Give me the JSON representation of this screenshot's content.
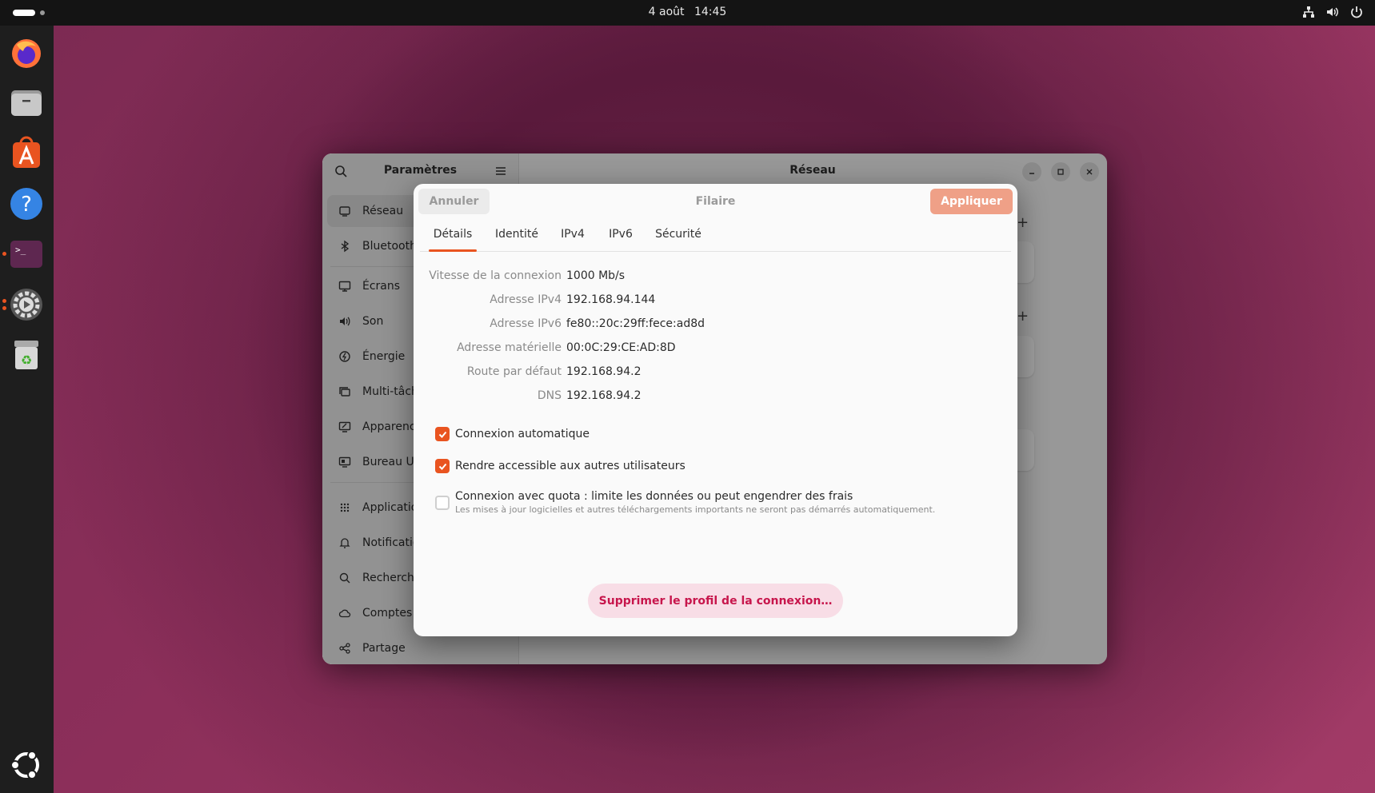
{
  "topbar": {
    "date": "4 août",
    "time": "14:45",
    "tray_icons": [
      "network-wired-icon",
      "volume-icon",
      "power-icon"
    ]
  },
  "dock": {
    "apps": [
      "firefox",
      "files",
      "app-center",
      "help",
      "terminal",
      "settings",
      "trash",
      "show-apps"
    ]
  },
  "window": {
    "sidebar_title": "Paramètres",
    "content_title": "Réseau",
    "sidebar_items": [
      {
        "label": "Réseau",
        "icon": "network-icon"
      },
      {
        "label": "Bluetooth",
        "icon": "bluetooth-icon"
      },
      {
        "label": "Écrans",
        "icon": "display-icon"
      },
      {
        "label": "Son",
        "icon": "speaker-icon"
      },
      {
        "label": "Énergie",
        "icon": "power-icon"
      },
      {
        "label": "Multi-tâch",
        "icon": "multitasking-icon"
      },
      {
        "label": "Apparenc",
        "icon": "appearance-icon"
      },
      {
        "label": "Bureau Ub",
        "icon": "desktop-icon"
      },
      {
        "label": "Applicatio",
        "icon": "apps-grid-icon"
      },
      {
        "label": "Notificatio",
        "icon": "bell-icon"
      },
      {
        "label": "Recherche",
        "icon": "search-icon"
      },
      {
        "label": "Comptes e",
        "icon": "cloud-icon"
      },
      {
        "label": "Partage",
        "icon": "share-icon"
      }
    ]
  },
  "dialog": {
    "cancel_label": "Annuler",
    "title": "Filaire",
    "apply_label": "Appliquer",
    "tabs": [
      "Détails",
      "Identité",
      "IPv4",
      "IPv6",
      "Sécurité"
    ],
    "active_tab": "Détails",
    "details": [
      {
        "label": "Vitesse de la connexion",
        "value": "1000 Mb/s"
      },
      {
        "label": "Adresse IPv4",
        "value": "192.168.94.144"
      },
      {
        "label": "Adresse IPv6",
        "value": "fe80::20c:29ff:fece:ad8d"
      },
      {
        "label": "Adresse matérielle",
        "value": "00:0C:29:CE:AD:8D"
      },
      {
        "label": "Route par défaut",
        "value": "192.168.94.2"
      },
      {
        "label": "DNS",
        "value": "192.168.94.2"
      }
    ],
    "checkboxes": [
      {
        "label": "Connexion automatique",
        "checked": true
      },
      {
        "label": "Rendre accessible aux autres utilisateurs",
        "checked": true
      },
      {
        "label": "Connexion avec quota : limite les données ou peut engendrer des frais",
        "sublabel": "Les mises à jour logicielles et autres téléchargements importants ne seront pas démarrés automatiquement.",
        "checked": false
      }
    ],
    "delete_label": "Supprimer le profil de la connexion…"
  },
  "colors": {
    "accent": "#e95420",
    "apply_button": "#efa087",
    "delete_text": "#c7164c",
    "delete_bg": "#f8dde6"
  }
}
